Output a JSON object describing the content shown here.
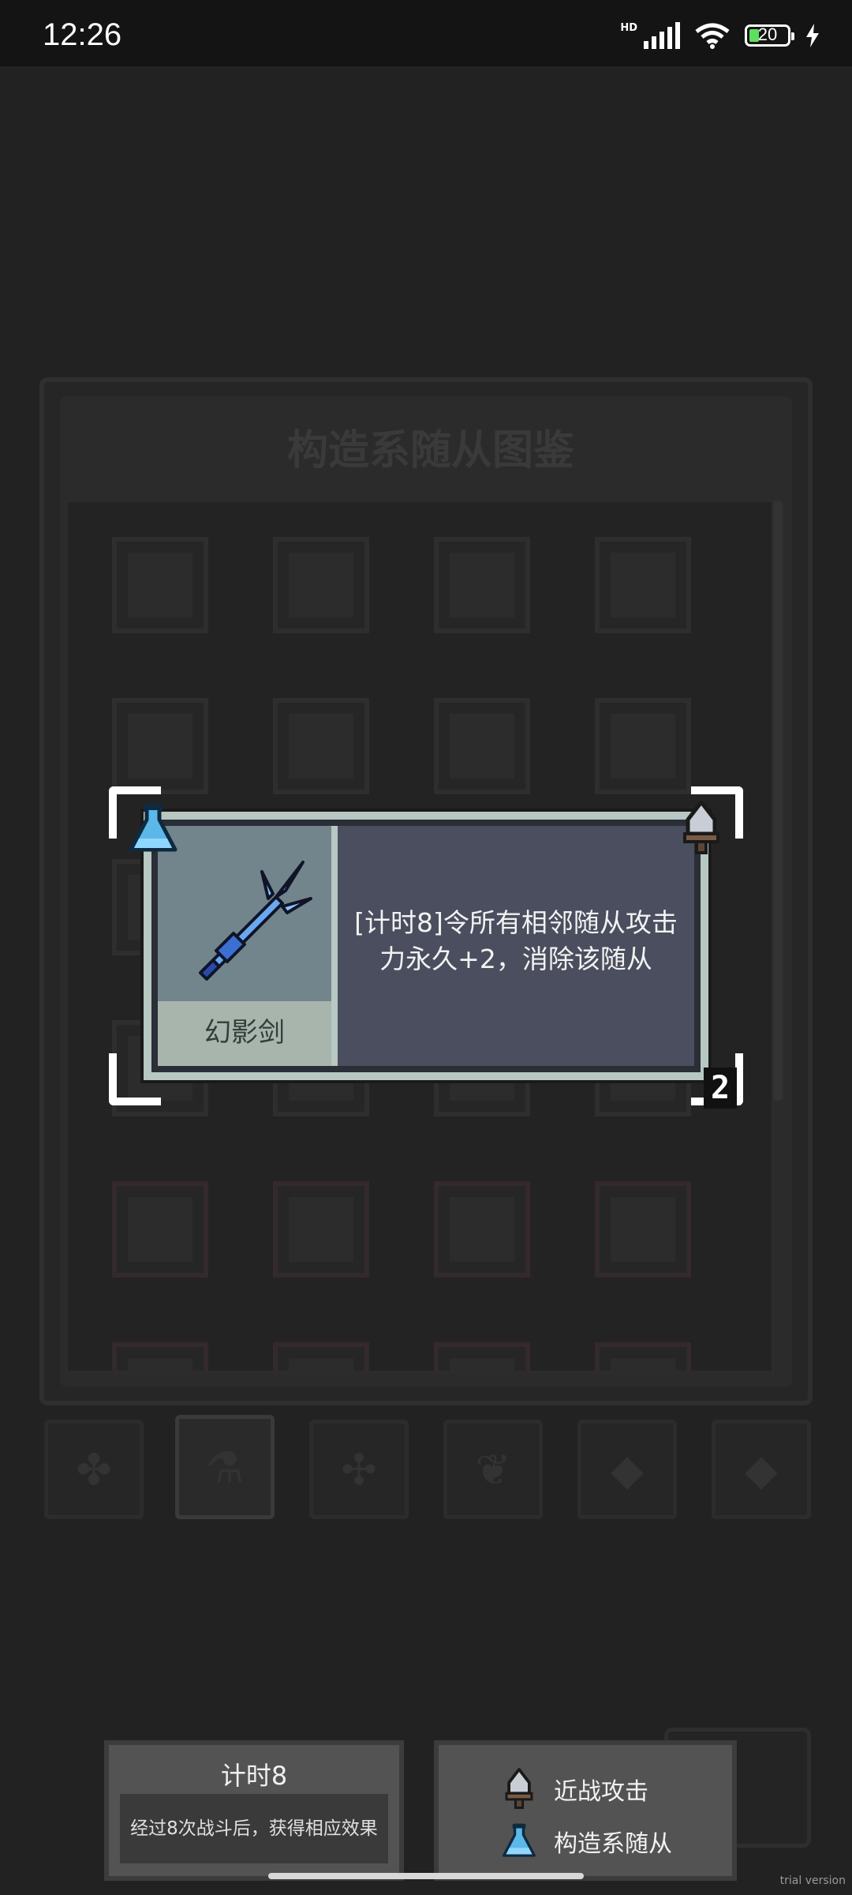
{
  "status_bar": {
    "time": "12:26",
    "network": "HD",
    "battery": "20"
  },
  "codex": {
    "title": "构造系随从图鉴",
    "categories": [
      {
        "icon": "clover",
        "glyph": "✤"
      },
      {
        "icon": "flask",
        "glyph": "⚗"
      },
      {
        "icon": "gear",
        "glyph": "✣"
      },
      {
        "icon": "fox",
        "glyph": "❦"
      },
      {
        "icon": "blue-gem",
        "glyph": "◆"
      },
      {
        "icon": "purple-gem",
        "glyph": "◆"
      }
    ],
    "active_category": "flask"
  },
  "card": {
    "name": "幻影剑",
    "description": "[计时8]令所有相邻随从攻击力永久+2，消除该随从",
    "rank": "2",
    "type_icon": "flask",
    "attack_icon": "sword"
  },
  "keyword_panel": {
    "title": "计时8",
    "description": "经过8次战斗后，获得相应效果"
  },
  "tags_panel": {
    "tags": [
      {
        "icon": "sword",
        "label": "近战攻击"
      },
      {
        "icon": "flask",
        "label": "构造系随从"
      }
    ]
  },
  "watermark": "trial version",
  "colors": {
    "card_border": "#b7c7c2",
    "portrait_bg": "#72858c",
    "desc_bg": "#4a4e5e",
    "flask_blue": "#5bb8e8",
    "sword_blue": "#6aa8f0"
  }
}
